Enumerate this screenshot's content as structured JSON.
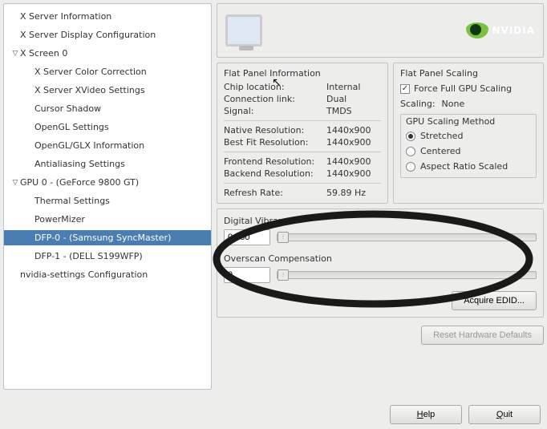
{
  "sidebar": {
    "items": [
      {
        "label": "X Server Information",
        "depth": 0,
        "exp": null,
        "selected": false
      },
      {
        "label": "X Server Display Configuration",
        "depth": 0,
        "exp": null,
        "selected": false
      },
      {
        "label": "X Screen 0",
        "depth": 0,
        "exp": "open",
        "selected": false
      },
      {
        "label": "X Server Color Correction",
        "depth": 1,
        "exp": null,
        "selected": false
      },
      {
        "label": "X Server XVideo Settings",
        "depth": 1,
        "exp": null,
        "selected": false
      },
      {
        "label": "Cursor Shadow",
        "depth": 1,
        "exp": null,
        "selected": false
      },
      {
        "label": "OpenGL Settings",
        "depth": 1,
        "exp": null,
        "selected": false
      },
      {
        "label": "OpenGL/GLX Information",
        "depth": 1,
        "exp": null,
        "selected": false
      },
      {
        "label": "Antialiasing Settings",
        "depth": 1,
        "exp": null,
        "selected": false
      },
      {
        "label": "GPU 0 - (GeForce 9800 GT)",
        "depth": 0,
        "exp": "open",
        "selected": false
      },
      {
        "label": "Thermal Settings",
        "depth": 1,
        "exp": null,
        "selected": false
      },
      {
        "label": "PowerMizer",
        "depth": 1,
        "exp": null,
        "selected": false
      },
      {
        "label": "DFP-0 - (Samsung SyncMaster)",
        "depth": 1,
        "exp": null,
        "selected": true
      },
      {
        "label": "DFP-1 - (DELL S199WFP)",
        "depth": 1,
        "exp": null,
        "selected": false
      },
      {
        "label": "nvidia-settings Configuration",
        "depth": 0,
        "exp": null,
        "selected": false
      }
    ]
  },
  "banner": {
    "brand": "NVIDIA"
  },
  "info": {
    "title": "Flat Panel Information",
    "rows": {
      "chip_loc_k": "Chip location:",
      "chip_loc_v": "Internal",
      "conn_k": "Connection link:",
      "conn_v": "Dual",
      "signal_k": "Signal:",
      "signal_v": "TMDS",
      "native_k": "Native Resolution:",
      "native_v": "1440x900",
      "bestfit_k": "Best Fit Resolution:",
      "bestfit_v": "1440x900",
      "frontend_k": "Frontend Resolution:",
      "frontend_v": "1440x900",
      "backend_k": "Backend Resolution:",
      "backend_v": "1440x900",
      "refresh_k": "Refresh Rate:",
      "refresh_v": "59.89 Hz"
    }
  },
  "scaling": {
    "title": "Flat Panel Scaling",
    "force_label": "Force Full GPU Scaling",
    "force_checked": true,
    "scaling_label": "Scaling:",
    "scaling_value": "None",
    "method_title": "GPU Scaling Method",
    "options": [
      {
        "label": "Stretched",
        "selected": true
      },
      {
        "label": "Centered",
        "selected": false
      },
      {
        "label": "Aspect Ratio Scaled",
        "selected": false
      }
    ]
  },
  "sliders": {
    "dv_label": "Digital Vibrance",
    "dv_value": "0.000",
    "overscan_label": "Overscan Compensation",
    "overscan_value": "0"
  },
  "buttons": {
    "acquire": "Acquire EDID...",
    "reset": "Reset Hardware Defaults",
    "help": "Help",
    "quit": "Quit"
  }
}
